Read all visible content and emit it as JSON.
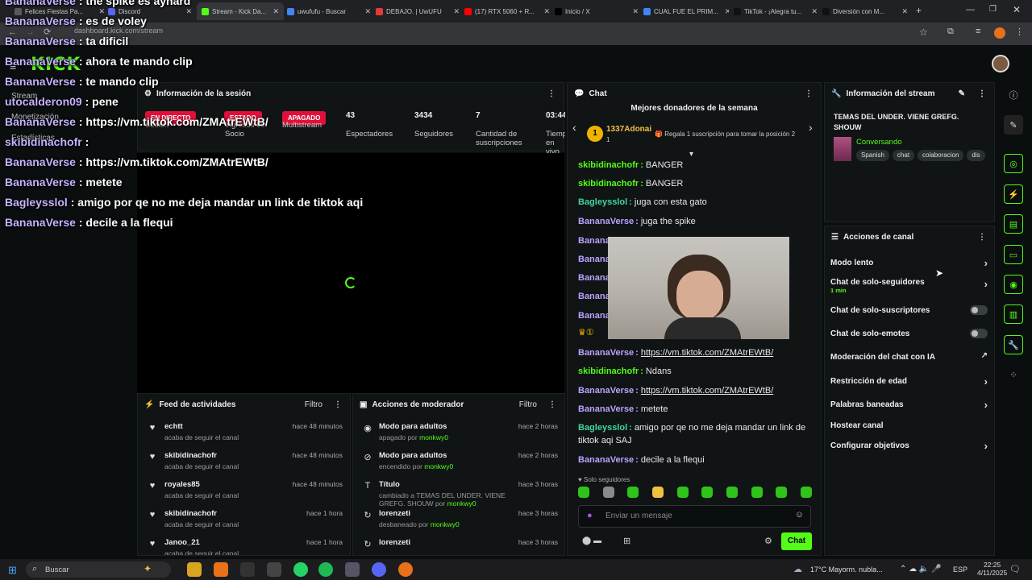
{
  "browser": {
    "tabs": [
      {
        "label": "Felices Fiestas Pa...",
        "color": "#5a5a5a"
      },
      {
        "label": "Discord",
        "color": "#5865f2"
      },
      {
        "label": "Stream - Kick Da...",
        "color": "#53fc18"
      },
      {
        "label": "uwufufu - Buscar",
        "color": "#4285f4"
      },
      {
        "label": "DEBAJO. | UwUFU",
        "color": "#e53935"
      },
      {
        "label": "(17) RTX 5060 + R...",
        "color": "#ff0000"
      },
      {
        "label": "Inicio / X",
        "color": "#000000"
      },
      {
        "label": "CUAL FUE EL PRIM...",
        "color": "#4285f4"
      },
      {
        "label": "TikTok - ¡Alegra tu...",
        "color": "#111111"
      },
      {
        "label": "Diversión con M...",
        "color": "#111111"
      }
    ],
    "url": "dashboard.kick.com/stream"
  },
  "brand": {
    "logo": "KICK",
    "accent": "#53fc18"
  },
  "nav": {
    "stream": "Stream",
    "monetization": "Monetización",
    "stats": "Estadísticas"
  },
  "session": {
    "title": "Información de la sesión",
    "live_badge": "EN DIRECTO",
    "partner_badge": "ESTADO",
    "multistream_badge": "APAGADO",
    "stats": [
      {
        "value": "",
        "label": "Sesión"
      },
      {
        "value": "",
        "label": "Ingresos de Socio"
      },
      {
        "value": "",
        "label": "Multistream"
      },
      {
        "value": "43",
        "label": "Espectadores"
      },
      {
        "value": "3434",
        "label": "Seguidores"
      },
      {
        "value": "7",
        "label": "Cantidad de suscripciones"
      },
      {
        "value": "03:44",
        "label": "Tiempo en vivo"
      }
    ]
  },
  "overlay_chat": [
    {
      "user": "BananaVerse",
      "text": "the spike es aynard"
    },
    {
      "user": "BananaVerse",
      "text": "es de voley"
    },
    {
      "user": "BananaVerse",
      "text": "ta dificil"
    },
    {
      "user": "BananaVerse",
      "text": "ahora te mando clip"
    },
    {
      "user": "BananaVerse",
      "text": "te mando clip"
    },
    {
      "user": "utocalderon09",
      "text": "pene"
    },
    {
      "user": "BananaVerse",
      "text": "https://vm.tiktok.com/ZMAtrEWtB/"
    },
    {
      "user": "skibidinachofr",
      "text": ""
    },
    {
      "user": "BananaVerse",
      "text": "https://vm.tiktok.com/ZMAtrEWtB/"
    },
    {
      "user": "BananaVerse",
      "text": "metete"
    },
    {
      "user": "Bagleysslol",
      "text": "amigo por qe no me deja mandar un link de tiktok aqi"
    },
    {
      "user": "BananaVerse",
      "text": "decile a la flequi"
    }
  ],
  "feed": {
    "title": "Feed de actividades",
    "filter": "Filtro",
    "items": [
      {
        "name": "echtt",
        "sub": "acaba de seguir el canal",
        "time": "hace 48 minutos"
      },
      {
        "name": "skibidinachofr",
        "sub": "acaba de seguir el canal",
        "time": "hace 48 minutos"
      },
      {
        "name": "royales85",
        "sub": "acaba de seguir el canal",
        "time": "hace 48 minutos"
      },
      {
        "name": "skibidinachofr",
        "sub": "acaba de seguir el canal",
        "time": "hace 1 hora"
      },
      {
        "name": "Janoo_21",
        "sub": "acaba de seguir el canal",
        "time": "hace 1 hora"
      }
    ]
  },
  "mod": {
    "title": "Acciones de moderador",
    "filter": "Filtro",
    "items": [
      {
        "name": "Modo para adultos",
        "sub": "apagado por",
        "by": "monkwy0",
        "time": "hace 2 horas"
      },
      {
        "name": "Modo para adultos",
        "sub": "encendido por",
        "by": "monkwy0",
        "time": "hace 2 horas"
      },
      {
        "name": "Título",
        "sub": "cambiado a TEMAS DEL UNDER. VIENE GREFG. SHOUW por",
        "by": "monkwy0",
        "time": "hace 3 horas"
      },
      {
        "name": "lorenzeti",
        "sub": "desbaneado por",
        "by": "monkwy0",
        "time": "hace 3 horas"
      },
      {
        "name": "lorenzeti",
        "sub": "",
        "by": "",
        "time": "hace 3 horas"
      }
    ]
  },
  "chat": {
    "title": "Chat",
    "donors_title": "Mejores donadores de la semana",
    "donor_name": "1337Adonai",
    "donor_count": "1",
    "donor_cta": "Regala 1 suscripción para tomar la posición 2",
    "messages": [
      {
        "user": "skibidinachofr",
        "text": "BANGER",
        "color": "#53fc18"
      },
      {
        "user": "skibidinachofr",
        "text": "BANGER",
        "color": "#53fc18"
      },
      {
        "user": "Bagleysslol",
        "text": "juga con esta gato",
        "color": "#3fd6a0"
      },
      {
        "user": "BananaVerse",
        "text": "juga the spike",
        "color": "#b9a3ff"
      },
      {
        "user": "BananaVerse",
        "text": "https://vm.tiktok.com/ZMAtrEWtB/",
        "color": "#b9a3ff",
        "link": true
      },
      {
        "user": "skibidinachofr",
        "text": "Ndans",
        "color": "#53fc18"
      },
      {
        "user": "BananaVerse",
        "text": "https://vm.tiktok.com/ZMAtrEWtB/",
        "color": "#b9a3ff",
        "link": true
      },
      {
        "user": "BananaVerse",
        "text": "metete",
        "color": "#b9a3ff"
      },
      {
        "user": "Bagleysslol",
        "text": "amigo por qe no me deja mandar un link de tiktok aqi SAJ",
        "color": "#3fd6a0"
      },
      {
        "user": "BananaVerse",
        "text": "decile a la flequi",
        "color": "#b9a3ff"
      }
    ],
    "hidden_user": "Banana",
    "followers_only": "Solo seguidores",
    "input_placeholder": "Enviar un mensaje",
    "send_label": "Chat"
  },
  "stream_info": {
    "title": "Información del stream",
    "stream_title": "TEMAS DEL UNDER. VIENE GREFG. SHOUW",
    "category": "Conversando",
    "tags": [
      "Spanish",
      "chat",
      "colaboracion",
      "dis"
    ]
  },
  "channel_actions": {
    "title": "Acciones de canal",
    "items": [
      {
        "label": "Modo lento",
        "kind": "chev"
      },
      {
        "label": "Chat de solo-seguidores",
        "sub": "1 min",
        "kind": "chev"
      },
      {
        "label": "Chat de solo-suscriptores",
        "kind": "toggle"
      },
      {
        "label": "Chat de solo-emotes",
        "kind": "toggle"
      },
      {
        "label": "Moderación del chat con IA",
        "kind": "ext"
      },
      {
        "label": "Restricción de edad",
        "kind": "chev"
      },
      {
        "label": "Palabras baneadas",
        "kind": "chev"
      },
      {
        "label": "Hostear canal",
        "kind": "none"
      },
      {
        "label": "Configurar objetivos",
        "kind": "chev"
      }
    ]
  },
  "taskbar": {
    "search": "Buscar",
    "weather": "17°C  Mayorm. nubla...",
    "lang": "ESP",
    "time": "22:25",
    "date": "4/11/2025"
  }
}
